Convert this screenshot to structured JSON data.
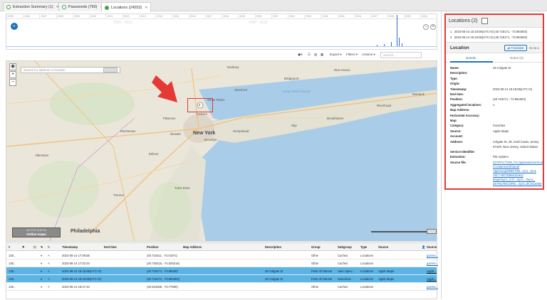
{
  "tabs": [
    {
      "label": "Extraction Summary (1)",
      "active": false
    },
    {
      "label": "Passwords (769)",
      "active": false
    },
    {
      "label": "Locations (24553)",
      "active": true
    }
  ],
  "timeline": {
    "years": [
      "2005",
      "2006",
      "2007",
      "2008",
      "2009",
      "2010",
      "2011",
      "2012",
      "2013",
      "2014",
      "2015",
      "2016",
      "2017",
      "2018",
      "2019",
      "2020",
      "2021",
      "2022",
      "2023",
      "2024",
      "2025",
      "2026",
      "2027",
      "2028",
      "2029",
      "2030"
    ],
    "range_left": "2000 - 2019",
    "range_right": "2000 - 2019",
    "zoom_out": "−",
    "zoom_in": "+"
  },
  "toolbar": {
    "export": "Export",
    "filters": "Filters",
    "actions": "Actions",
    "search_placeholder": "Search..."
  },
  "map": {
    "search_placeholder": "Search for address or location",
    "zoom_in": "+",
    "zoom_out": "−",
    "online_coords": "40.72°N 73.93°W",
    "online_label": "Online maps",
    "marker_label": "2",
    "places": [
      {
        "t": "Long Island Sound",
        "cls": "sound"
      },
      {
        "t": "New York",
        "cls": "big"
      },
      {
        "t": "Philadelphia",
        "cls": "big"
      },
      {
        "t": "Newark"
      },
      {
        "t": "Yonkers"
      },
      {
        "t": "Stamford"
      },
      {
        "t": "Bridgeport"
      },
      {
        "t": "New Haven"
      },
      {
        "t": "Danbury"
      },
      {
        "t": "Paterson"
      },
      {
        "t": "Brooklyn"
      },
      {
        "t": "Hempstead"
      },
      {
        "t": "Trenton"
      },
      {
        "t": "Allentown"
      },
      {
        "t": "Islip"
      },
      {
        "t": "Brookhaven"
      },
      {
        "t": "Riverhead"
      },
      {
        "t": "Montauk"
      },
      {
        "t": "Toms River"
      },
      {
        "t": "Edison"
      },
      {
        "t": "Morristown"
      },
      {
        "t": "White Plains"
      }
    ]
  },
  "table": {
    "headers": [
      "#",
      "",
      "",
      "",
      "Timestamp",
      "End time",
      "Position",
      "Map Address",
      "Description",
      "Group",
      "Subgroup",
      "Type",
      "Source",
      "Source"
    ],
    "rows": [
      {
        "id": "130...",
        "flag": "",
        "ts": "2023-06-14 17:09:58",
        "end": "",
        "pos": "(40.710411, -74.01871)",
        "addr": "",
        "desc": "",
        "group": "Other",
        "sub": "Cached",
        "type": "Locations",
        "source": "",
        "src2": "gazeta...",
        "sel": false
      },
      {
        "id": "130...",
        "flag": "",
        "ts": "2023-06-14 17:02:34",
        "end": "",
        "pos": "(40.730416, -74.025216)",
        "addr": "",
        "desc": "",
        "group": "Other",
        "sub": "Cached",
        "type": "Locations",
        "source": "",
        "src2": "gazeta...",
        "sel": false
      },
      {
        "id": "130...",
        "flag": "",
        "ts": "2023-06-14 16:18:06(UTC+0)",
        "end": "",
        "pos": "(40.719171, -73.99400)",
        "addr": "",
        "desc": "49 Colgate St",
        "group": "Point of Interest",
        "sub": "User Speci...",
        "type": "Locations",
        "source": "Apple Maps",
        "src2": "Apple...",
        "sel": true
      },
      {
        "id": "130...",
        "flag": "",
        "ts": "2023-06-14 16:18:06(UTC+0)",
        "end": "",
        "pos": "(40.719171, -73.994003)",
        "addr": "",
        "desc": "49 Colgate St",
        "group": "Point of Interest",
        "sub": "Searched...",
        "type": "Locations",
        "source": "Apple Maps",
        "src2": "Apple...",
        "sel": true
      },
      {
        "id": "130...",
        "flag": "",
        "ts": "2023-06-14 15:27:44",
        "end": "",
        "pos": "(40.624928, -73.77900)",
        "addr": "",
        "desc": "",
        "group": "Other",
        "sub": "Cached",
        "type": "Locations",
        "source": "",
        "src2": "gazeta...",
        "sel": false
      }
    ]
  },
  "panel": {
    "title": "Locations (2)",
    "list": [
      {
        "n": "1",
        "t": "2023-06-14 16:18:06(UTC+0)  (40.719171, -73.994003)"
      },
      {
        "n": "2",
        "t": "2023-06-14 16:18:06(UTC+0)  (40.719171, -73.994003)"
      }
    ],
    "section_title": "Location",
    "translate": "Translate",
    "goto": "Go to",
    "tab_details": "Details",
    "tab_notes": "Notes (0)",
    "fields": [
      {
        "k": "Name:",
        "v": "49 Colgate St"
      },
      {
        "k": "Description:",
        "v": ""
      },
      {
        "k": "Type:",
        "v": ""
      },
      {
        "k": "Origin:",
        "v": ""
      },
      {
        "k": "Timestamp:",
        "v": "2023-06-14 16:18:06(UTC+0)"
      },
      {
        "k": "End time:",
        "v": ""
      },
      {
        "k": "Position:",
        "v": "(40.719171, -73.994003)"
      },
      {
        "k": "Aggregated locations:",
        "v": "1"
      },
      {
        "k": "Map Address:",
        "v": ""
      },
      {
        "k": "Horizontal Accuracy:",
        "v": ""
      },
      {
        "k": "Map:",
        "v": ""
      },
      {
        "k": "Category:",
        "v": "Favorites"
      },
      {
        "k": "Source:",
        "v": "Apple Maps"
      },
      {
        "k": "Account:",
        "v": ""
      },
      {
        "k": "Address:",
        "v": "Colgate St, 49, Gold Coast, Jersey"
      },
      {
        "k": "Service Identifier:",
        "v": ""
      },
      {
        "k": "Extraction:",
        "v": "File System"
      },
      {
        "k": "Source file:",
        "v": "EXTRACTION_FS.zip/private/var/mobile/Containers/Shared/AppGroup/0000-F82.../Library/Maps/Sync_0.0/...Sync.../Sync_Sync.db"
      }
    ],
    "address_cont": "07429, New Jersey, United States",
    "source_file_lines": [
      "EXTRACTION_FS.zip/private/var/mobile",
      "/Containers/Shared/",
      "AppGroup/0000-F82...1C1...DA1",
      "A0C7-9D7DB6/Library/",
      "Maps/Sync_0.0/...Sync.../Sync_",
      "ZSYNCRECORD...Sync.db (0x3286)"
    ]
  }
}
